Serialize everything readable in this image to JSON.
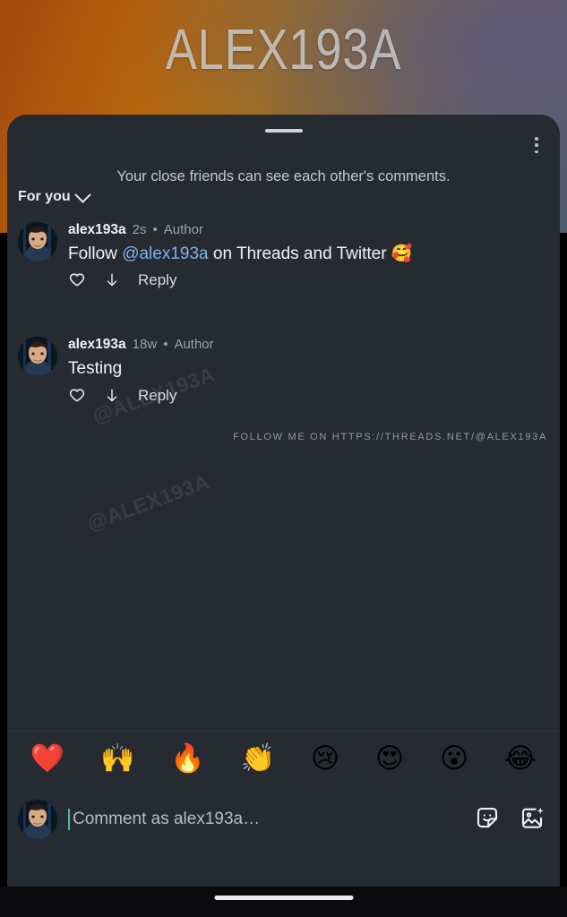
{
  "backdrop": {
    "title": "ALEX193A"
  },
  "sheet": {
    "drag_handle": "drag-handle",
    "menu_icon": "kebab-menu-icon",
    "close_friends_note": "Your close friends can see each other's comments.",
    "filter": {
      "label": "For you",
      "chevron": "chevron-down-icon"
    }
  },
  "watermarks": {
    "diagonal": "@ALEX193A",
    "url_line": "FOLLOW ME ON HTTPS://THREADS.NET/@ALEX193A"
  },
  "comments": [
    {
      "username": "alex193a",
      "time": "2s",
      "separator": "•",
      "badge": "Author",
      "text_before": "Follow ",
      "mention": "@alex193a",
      "text_after": " on Threads and Twitter 🥰",
      "like_icon": "heart-outline-icon",
      "share_icon": "down-arrow-icon",
      "reply_label": "Reply"
    },
    {
      "username": "alex193a",
      "time": "18w",
      "separator": "•",
      "badge": "Author",
      "text_before": "Testing",
      "mention": "",
      "text_after": "",
      "like_icon": "heart-outline-icon",
      "share_icon": "down-arrow-icon",
      "reply_label": "Reply"
    }
  ],
  "emoji_bar": [
    {
      "name": "red-heart-emoji",
      "glyph": "❤️"
    },
    {
      "name": "raising-hands-emoji",
      "glyph": "🙌"
    },
    {
      "name": "fire-emoji",
      "glyph": "🔥"
    },
    {
      "name": "clapping-hands-emoji",
      "glyph": "👏"
    },
    {
      "name": "crying-face-emoji",
      "glyph": "😢"
    },
    {
      "name": "heart-eyes-emoji",
      "glyph": "😍"
    },
    {
      "name": "surprised-face-emoji",
      "glyph": "😮"
    },
    {
      "name": "tears-of-joy-emoji",
      "glyph": "😂"
    }
  ],
  "composer": {
    "avatar": "user-avatar",
    "placeholder": "Comment as alex193a…",
    "sticker_icon": "sticker-icon",
    "gif_image_icon": "image-sparkle-icon"
  },
  "system": {
    "home_indicator": "home-indicator"
  },
  "colors": {
    "sheet_bg": "#262a31",
    "mention_blue": "#7fb2e5",
    "caret_teal": "#4fb8a0",
    "muted_text": "#9aa1aa"
  }
}
